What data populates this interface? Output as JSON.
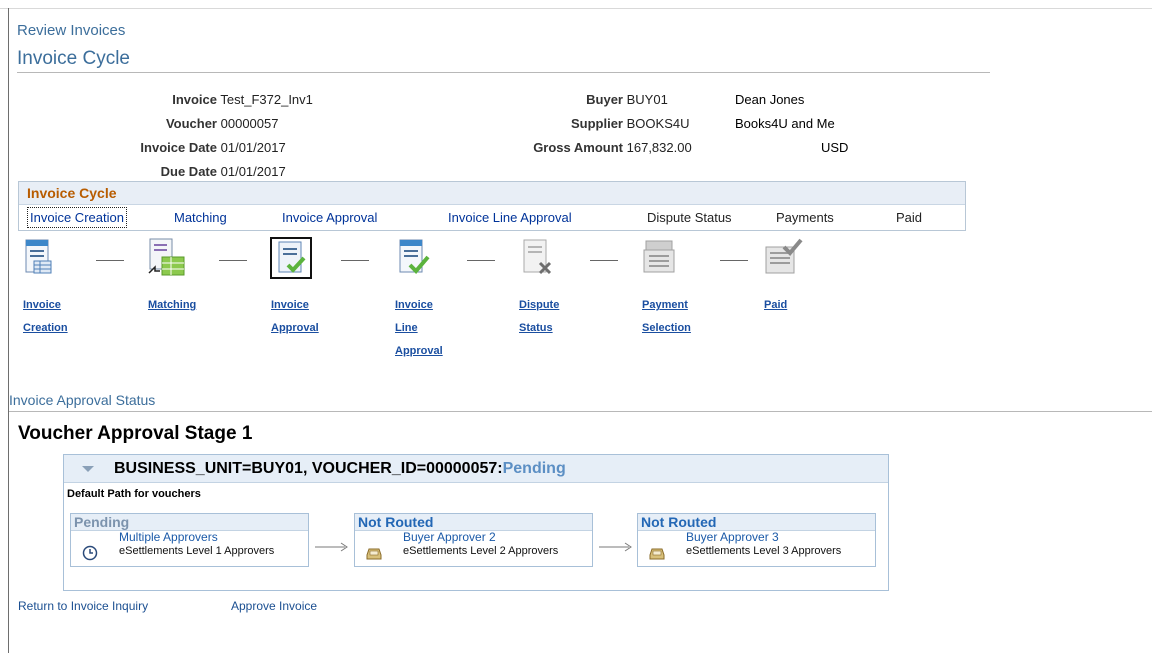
{
  "breadcrumb": "Review Invoices",
  "page_title": "Invoice Cycle",
  "details": {
    "invoice_label": "Invoice",
    "invoice_value": "Test_F372_Inv1",
    "voucher_label": "Voucher",
    "voucher_value": "00000057",
    "invoice_date_label": "Invoice Date",
    "invoice_date_value": "01/01/2017",
    "due_date_label": "Due Date",
    "due_date_value": "01/01/2017",
    "buyer_label": "Buyer",
    "buyer_value": "BUY01",
    "buyer_name": "Dean Jones",
    "supplier_label": "Supplier",
    "supplier_value": "BOOKS4U",
    "supplier_name": "Books4U and Me",
    "gross_amount_label": "Gross Amount",
    "gross_amount_value": "167,832.00",
    "currency": "USD"
  },
  "cycle": {
    "header": "Invoice Cycle",
    "tabs": [
      "Invoice Creation",
      "Matching",
      "Invoice Approval",
      "Invoice Line Approval",
      "Dispute Status",
      "Payments",
      "Paid"
    ],
    "steps": [
      {
        "lines": [
          "Invoice",
          "Creation"
        ]
      },
      {
        "lines": [
          "Matching"
        ]
      },
      {
        "lines": [
          "Invoice",
          "Approval"
        ]
      },
      {
        "lines": [
          "Invoice",
          "Line",
          "Approval"
        ]
      },
      {
        "lines": [
          "Dispute",
          "Status"
        ]
      },
      {
        "lines": [
          "Payment",
          "Selection"
        ]
      },
      {
        "lines": [
          "Paid"
        ]
      }
    ]
  },
  "approval": {
    "section_title": "Invoice Approval Status",
    "stage_title": "Voucher Approval Stage 1",
    "header_text": "BUSINESS_UNIT=BUY01, VOUCHER_ID=00000057:",
    "header_status": "Pending",
    "path_label": "Default Path for vouchers",
    "cards": [
      {
        "status": "Pending",
        "name": "Multiple Approvers",
        "desc": "eSettlements Level 1 Approvers",
        "icon": "clock-icon"
      },
      {
        "status": "Not Routed",
        "name": "Buyer Approver 2",
        "desc": "eSettlements Level 2 Approvers",
        "icon": "inbox-icon"
      },
      {
        "status": "Not Routed",
        "name": "Buyer Approver 3",
        "desc": "eSettlements Level 3 Approvers",
        "icon": "inbox-icon"
      }
    ]
  },
  "footer": {
    "return_link": "Return to Invoice Inquiry",
    "approve_link": "Approve Invoice"
  }
}
